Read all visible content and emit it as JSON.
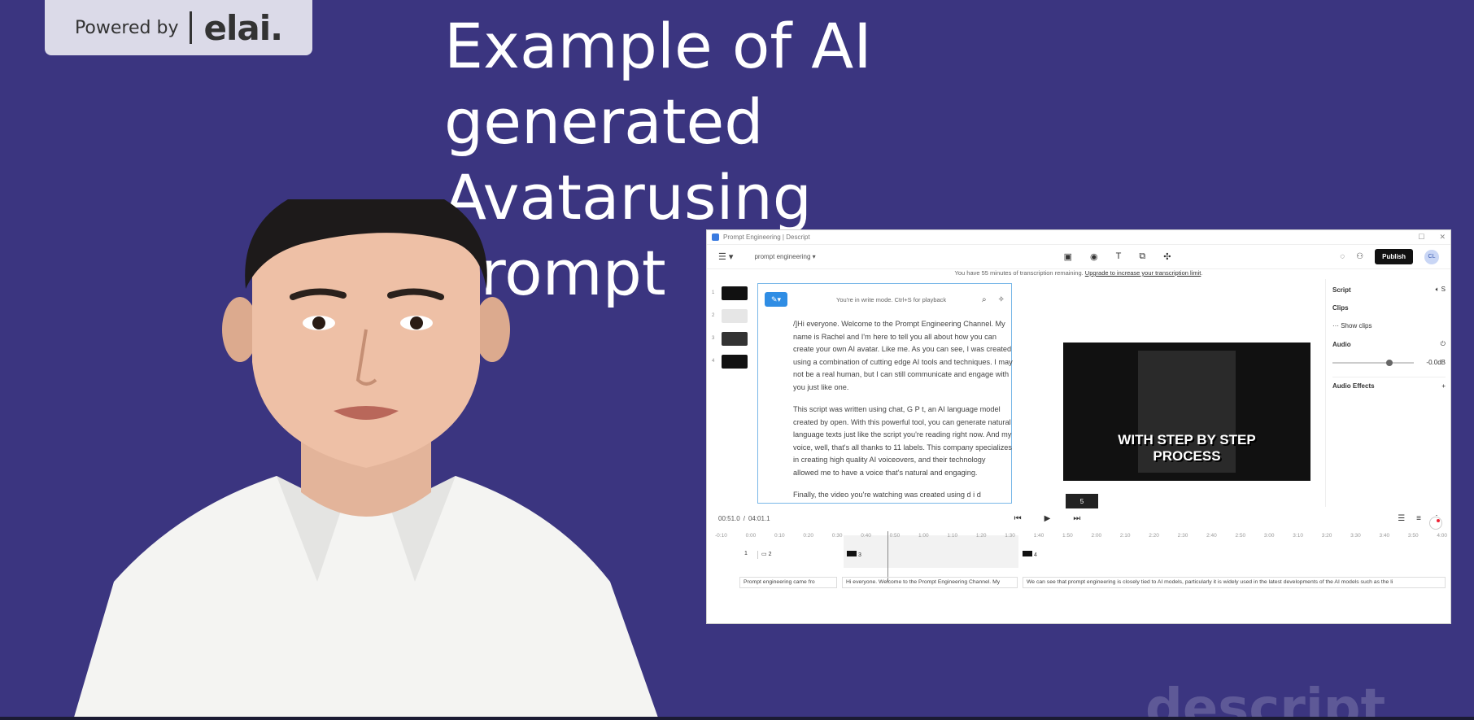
{
  "badge": {
    "label": "Powered by",
    "brand": "elai."
  },
  "headline": {
    "line1": "Example of AI",
    "line2": "generated Avatarusing",
    "line3": "Prompt"
  },
  "watermark": "descript",
  "app": {
    "window_title": "Prompt Engineering | Descript",
    "project_name": "prompt engineering",
    "publish_label": "Publish",
    "avatar_initials": "CL",
    "notice_text": "You have 55 minutes of transcription remaining.",
    "notice_link": "Upgrade to increase your transcription limit",
    "editor": {
      "hint": "You're in write mode. Ctrl+S for playback",
      "paragraphs": [
        "/]Hi everyone. Welcome to the Prompt Engineering Channel. My name is Rachel and I'm here to tell you all about how you can create your own AI avatar. Like me. As you can see, I was created using a combination of cutting edge AI tools and techniques. I may not be a real human, but I can still communicate and engage with you just like one.",
        "This script was written using chat, G P t, an AI language model created by open. With this powerful tool, you can generate natural language texts just like the script you're reading right now. And my voice, well, that's all thanks to 11 labels. This company specializes in creating high quality AI voiceovers, and their technology allowed me to have a voice that's natural and engaging.",
        "Finally, the video you're watching was created using d i d"
      ]
    },
    "thumbnails": [
      "1",
      "2",
      "3",
      "4"
    ],
    "video": {
      "caption_line1": "WITH STEP BY STEP",
      "caption_line2": "PROCESS",
      "badge": "5"
    },
    "panel": {
      "script_label": "Script",
      "clips_label": "Clips",
      "show_clips": "Show clips",
      "audio_label": "Audio",
      "volume": "-0.0dB",
      "audio_effects": "Audio Effects"
    },
    "transport": {
      "time_current": "00:51.0",
      "time_sep": "/",
      "time_total": "04:01.1"
    },
    "ruler": [
      "-0:10",
      "0:00",
      "0:10",
      "0:20",
      "0:30",
      "0:40",
      "0:50",
      "1:00",
      "1:10",
      "1:20",
      "1:30",
      "1:40",
      "1:50",
      "2:00",
      "2:10",
      "2:20",
      "2:30",
      "2:40",
      "2:50",
      "3:00",
      "3:10",
      "3:20",
      "3:30",
      "3:40",
      "3:50",
      "4:00"
    ],
    "tracks": {
      "t1": "1",
      "t2": "2",
      "t3": "3",
      "t4": "4"
    },
    "transcript": [
      "Prompt engineering came fro",
      "Hi everyone. Welcome to the Prompt Engineering Channel. My",
      "We can see that prompt engineering is closely tied to AI models, particularly it is widely used in the latest developments of the AI models such as the li"
    ]
  }
}
